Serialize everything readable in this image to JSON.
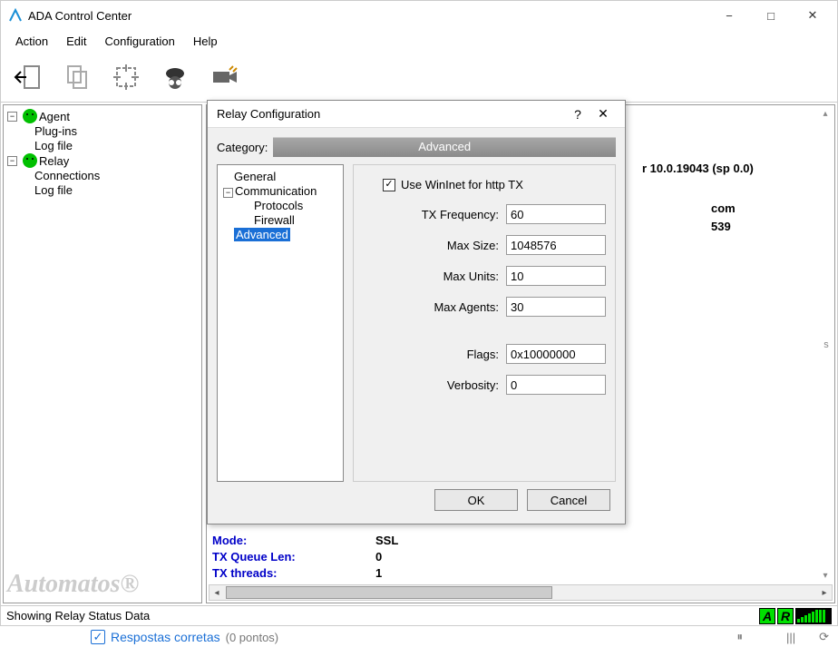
{
  "window": {
    "title": "ADA Control Center",
    "min_label": "−",
    "max_label": "□",
    "close_label": "✕"
  },
  "menubar": {
    "action": "Action",
    "edit": "Edit",
    "configuration": "Configuration",
    "help": "Help"
  },
  "tree": {
    "agent": "Agent",
    "agent_plugins": "Plug-ins",
    "agent_logfile": "Log file",
    "relay": "Relay",
    "relay_connections": "Connections",
    "relay_logfile": "Log file",
    "minus": "−"
  },
  "right": {
    "os_tail": "r 10.0.19043 (sp 0.0)",
    "com": "com",
    "num": "539",
    "mode_lbl": "Mode:",
    "mode_val": "SSL",
    "txq_lbl": "TX Queue Len:",
    "txq_val": "0",
    "txth_lbl": "TX threads:",
    "txth_val": "1"
  },
  "logo": "Automatos®",
  "status": {
    "text": "Showing Relay Status Data",
    "A": "A",
    "R": "R"
  },
  "dialog": {
    "title": "Relay Configuration",
    "help": "?",
    "close": "✕",
    "category_label": "Category:",
    "banner": "Advanced",
    "tree": {
      "general": "General",
      "communication": "Communication",
      "protocols": "Protocols",
      "firewall": "Firewall",
      "advanced": "Advanced",
      "minus": "−"
    },
    "form": {
      "use_wininet": "Use WinInet for http TX",
      "tx_freq_lbl": "TX Frequency:",
      "tx_freq_val": "60",
      "max_size_lbl": "Max Size:",
      "max_size_val": "1048576",
      "max_units_lbl": "Max Units:",
      "max_units_val": "10",
      "max_agents_lbl": "Max Agents:",
      "max_agents_val": "30",
      "flags_lbl": "Flags:",
      "flags_val": "0x10000000",
      "verbosity_lbl": "Verbosity:",
      "verbosity_val": "0"
    },
    "ok": "OK",
    "cancel": "Cancel"
  },
  "stray": {
    "check": "✓",
    "txt": "Respostas corretas",
    "pts": "(0 pontos)",
    "bars": "|||"
  }
}
